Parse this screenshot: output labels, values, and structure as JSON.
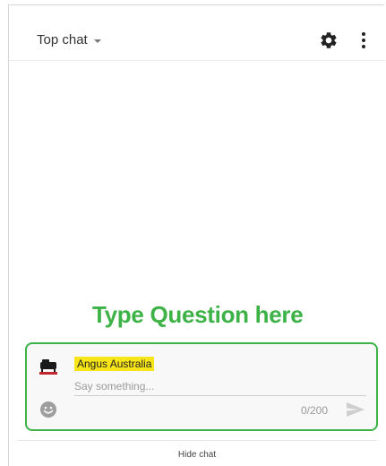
{
  "header": {
    "chat_mode_label": "Top chat",
    "icons": [
      "chevron-down-icon",
      "gear-icon",
      "more-vert-icon"
    ]
  },
  "annotation": {
    "text": "Type Question here",
    "color": "#3db247"
  },
  "composer": {
    "author_name": "Angus Australia",
    "author_highlight": "#f7e518",
    "placeholder": "Say something...",
    "char_count": "0/200",
    "icons": [
      "avatar-logo",
      "emoji-icon",
      "send-icon"
    ]
  },
  "footer": {
    "hide_chat_label": "Hide chat"
  }
}
